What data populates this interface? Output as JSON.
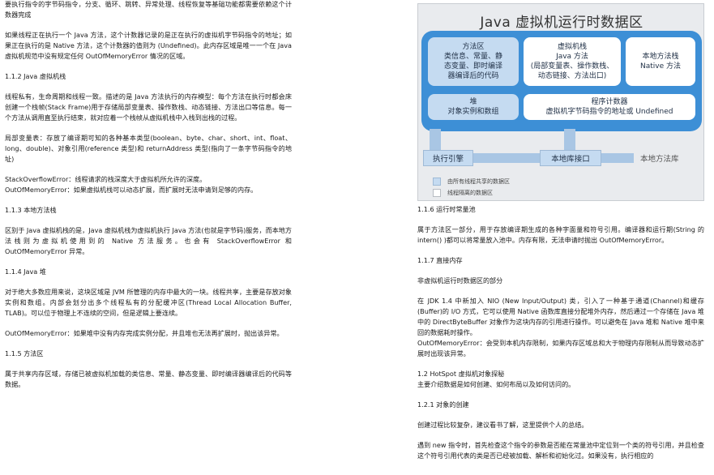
{
  "left": {
    "p_top": "要执行指令的字节码指令，分支、循环、跳转、异常处理、线程恢复等基础功能都需要依赖这个计数器完成",
    "p_native": "如果线程正在执行一个 Java 方法，这个计数器记录的是正在执行的虚拟机字节码指令的地址；如果正在执行的是 Native 方法，这个计数器的值则为 (Undefined)。此内存区域是唯一一个在 Java 虚拟机规范中没有规定任何 OutOfMemoryError 情况的区域。",
    "h_112": "1.1.2 Java 虚拟机栈",
    "p_stack": "线程私有，生命周期和线程一致。描述的是 Java 方法执行的内存模型：每个方法在执行时都会床创建一个栈帧(Stack Frame)用于存储局部变量表、操作数栈、动态链接、方法出口等信息。每一个方法从调用直至执行结束，就对应着一个栈帧从虚拟机栈中入栈到出栈的过程。",
    "p_locals": "局部变量表：存放了编译期可知的各种基本类型(boolean、byte、char、short、int、float、long、double)、对象引用(reference 类型)和 returnAddress 类型(指向了一条字节码指令的地址)",
    "p_soe": "StackOverflowError：线程请求的栈深度大于虚拟机所允许的深度。",
    "p_oome": "OutOfMemoryError：如果虚拟机栈可以动态扩展，而扩展时无法申请到足够的内存。",
    "h_113": "1.1.3 本地方法栈",
    "p_native_stack": "区别于 Java 虚拟机栈的是，Java 虚拟机栈为虚拟机执行 Java 方法(也就是字节码)服务，而本地方法栈则为虚拟机使用到的 Native 方法服务。也会有 StackOverflowError 和 OutOfMemoryError 异常。",
    "h_114": "1.1.4 Java 堆",
    "p_heap": "对于绝大多数应用来说，这块区域是 JVM 所管理的内存中最大的一块。线程共享，主要是存放对象实例和数组。内部会划分出多个线程私有的分配缓冲区(Thread Local Allocation Buffer, TLAB)。可以位于物理上不连续的空间，但是逻辑上要连续。",
    "p_heap_oome": "OutOfMemoryError：如果堆中没有内存完成实例分配，并且堆也无法再扩展时，抛出该异常。",
    "h_115": "1.1.5 方法区",
    "p_method": "属于共享内存区域，存储已被虚拟机加载的类信息、常量、静态变量、即时编译器编译后的代码等数据。"
  },
  "diagram": {
    "title": "Java 虚拟机运行时数据区",
    "method_area": [
      "方法区",
      "类信息、常量、静",
      "态变量、即时编译",
      "器编译后的代码"
    ],
    "vm_stack": [
      "虚拟机栈",
      "Java 方法",
      "(局部变量表、操作数栈、",
      "动态链接、方法出口)"
    ],
    "native_stack": [
      "本地方法栈",
      "Native 方法"
    ],
    "heap": [
      "堆",
      "对象实例和数组"
    ],
    "pc": [
      "程序计数器",
      "虚拟机字节码指令的地址或 Undefined"
    ],
    "engine": "执行引擎",
    "native_iface": "本地库接口",
    "native_lib": "本地方法库",
    "legend_shared": "由所有线程共享的数据区",
    "legend_private": "线程隔离的数据区",
    "colors": {
      "runtime": "#3d8fd6",
      "shared": "#c5dbf1",
      "private": "#ffffff"
    }
  },
  "right": {
    "h_116": "1.1.6 运行时常量池",
    "p_pool": "属于方法区一部分，用于存放编译期生成的各种字面量和符号引用。编译器和运行期(String 的 intern() )都可以将常量放入池中。内存有限，无法申请时抛出 OutOfMemoryError。",
    "h_117": "1.1.7 直接内存",
    "p_direct_title": "非虚拟机运行时数据区的部分",
    "p_nio": "在 JDK 1.4 中新加入 NIO (New Input/Output) 类，引入了一种基于通道(Channel)和缓存(Buffer)的 I/O 方式，它可以使用 Native 函数库直接分配堆外内存，然后通过一个存储在 Java 堆中的 DirectByteBuffer 对象作为这块内存的引用进行操作。可以避免在 Java 堆和 Native 堆中来回的数据耗时操作。",
    "p_direct_oome": "OutOfMemoryError：会受到本机内存限制，如果内存区域总和大于物理内存限制从而导致动态扩展时出现该异常。",
    "h_12": "1.2 HotSpot 虚拟机对象探秘",
    "p_12": "主要介绍数据是如何创建、如何布局以及如何访问的。",
    "h_121": "1.2.1 对象的创建",
    "p_create": "创建过程比较复杂，建议看书了解，这里提供个人的总结。",
    "p_new": "遇到 new 指令时，首先检查这个指令的参数是否能在常量池中定位到一个类的符号引用，并且检查这个符号引用代表的类是否已经被加载、解析和初始化过。如果没有，执行相应的"
  }
}
